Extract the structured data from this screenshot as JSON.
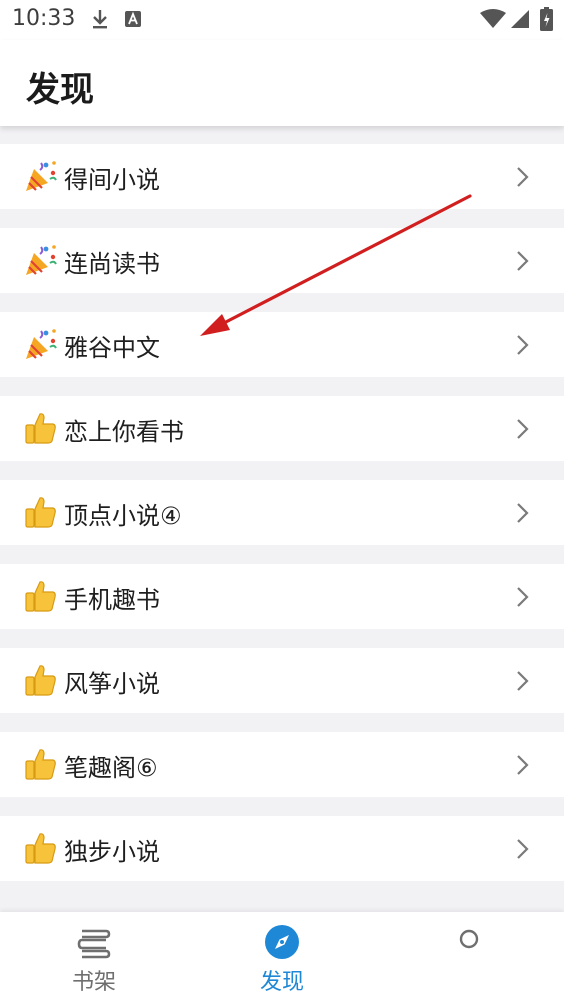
{
  "status_bar": {
    "time": "10:33",
    "icons": [
      "download-icon",
      "font-notification-icon",
      "wifi-icon",
      "signal-icon",
      "battery-icon"
    ]
  },
  "app_bar": {
    "title": "发现"
  },
  "list": {
    "items": [
      {
        "label": "得间小说",
        "emoji": "party-popper-icon"
      },
      {
        "label": "连尚读书",
        "emoji": "party-popper-icon"
      },
      {
        "label": "雅谷中文",
        "emoji": "party-popper-icon"
      },
      {
        "label": "恋上你看书",
        "emoji": "thumbs-up-icon"
      },
      {
        "label": "顶点小说④",
        "emoji": "thumbs-up-icon"
      },
      {
        "label": "手机趣书",
        "emoji": "thumbs-up-icon"
      },
      {
        "label": "风筝小说",
        "emoji": "thumbs-up-icon"
      },
      {
        "label": "笔趣阁⑥",
        "emoji": "thumbs-up-icon"
      },
      {
        "label": "独步小说",
        "emoji": "thumbs-up-icon"
      }
    ]
  },
  "bottom_nav": {
    "items": [
      {
        "label": "书架",
        "icon": "bookshelf-icon",
        "active": false
      },
      {
        "label": "发现",
        "icon": "compass-icon",
        "active": true
      },
      {
        "label": "",
        "icon": "circle-icon",
        "active": false
      }
    ]
  },
  "colors": {
    "accent": "#1e88d6",
    "background": "#f2f1f4",
    "annotation_arrow": "#d11f1f"
  }
}
